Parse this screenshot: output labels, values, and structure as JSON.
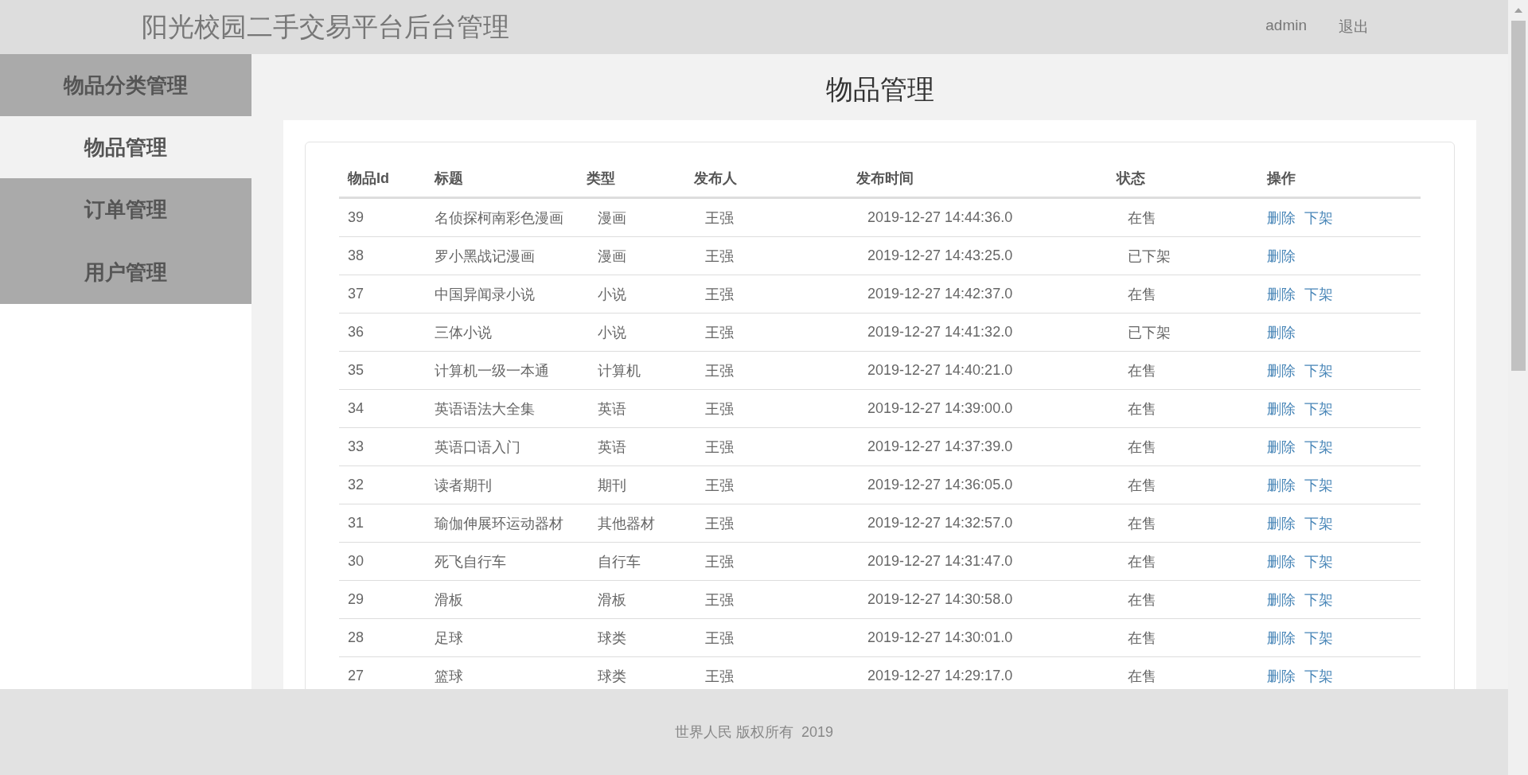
{
  "header": {
    "title": "阳光校园二手交易平台后台管理",
    "user": "admin",
    "logout": "退出"
  },
  "sidebar": {
    "items": [
      {
        "label": "物品分类管理",
        "selected": false
      },
      {
        "label": "物品管理",
        "selected": true
      },
      {
        "label": "订单管理",
        "selected": false
      },
      {
        "label": "用户管理",
        "selected": false
      }
    ]
  },
  "page_title": "物品管理",
  "table": {
    "columns": [
      "物品Id",
      "标题",
      "类型",
      "发布人",
      "发布时间",
      "状态",
      "操作"
    ],
    "rows": [
      {
        "cells": [
          "39",
          "名侦探柯南彩色漫画",
          "漫画",
          "王强",
          "2019-12-27 14:44:36.0",
          "在售"
        ],
        "actions": [
          "删除",
          "下架"
        ]
      },
      {
        "cells": [
          "38",
          "罗小黑战记漫画",
          "漫画",
          "王强",
          "2019-12-27 14:43:25.0",
          "已下架"
        ],
        "actions": [
          "删除"
        ]
      },
      {
        "cells": [
          "37",
          "中国异闻录小说",
          "小说",
          "王强",
          "2019-12-27 14:42:37.0",
          "在售"
        ],
        "actions": [
          "删除",
          "下架"
        ]
      },
      {
        "cells": [
          "36",
          "三体小说",
          "小说",
          "王强",
          "2019-12-27 14:41:32.0",
          "已下架"
        ],
        "actions": [
          "删除"
        ]
      },
      {
        "cells": [
          "35",
          "计算机一级一本通",
          "计算机",
          "王强",
          "2019-12-27 14:40:21.0",
          "在售"
        ],
        "actions": [
          "删除",
          "下架"
        ]
      },
      {
        "cells": [
          "34",
          "英语语法大全集",
          "英语",
          "王强",
          "2019-12-27 14:39:00.0",
          "在售"
        ],
        "actions": [
          "删除",
          "下架"
        ]
      },
      {
        "cells": [
          "33",
          "英语口语入门",
          "英语",
          "王强",
          "2019-12-27 14:37:39.0",
          "在售"
        ],
        "actions": [
          "删除",
          "下架"
        ]
      },
      {
        "cells": [
          "32",
          "读者期刊",
          "期刊",
          "王强",
          "2019-12-27 14:36:05.0",
          "在售"
        ],
        "actions": [
          "删除",
          "下架"
        ]
      },
      {
        "cells": [
          "31",
          "瑜伽伸展环运动器材",
          "其他器材",
          "王强",
          "2019-12-27 14:32:57.0",
          "在售"
        ],
        "actions": [
          "删除",
          "下架"
        ]
      },
      {
        "cells": [
          "30",
          "死飞自行车",
          "自行车",
          "王强",
          "2019-12-27 14:31:47.0",
          "在售"
        ],
        "actions": [
          "删除",
          "下架"
        ]
      },
      {
        "cells": [
          "29",
          "滑板",
          "滑板",
          "王强",
          "2019-12-27 14:30:58.0",
          "在售"
        ],
        "actions": [
          "删除",
          "下架"
        ]
      },
      {
        "cells": [
          "28",
          "足球",
          "球类",
          "王强",
          "2019-12-27 14:30:01.0",
          "在售"
        ],
        "actions": [
          "删除",
          "下架"
        ]
      },
      {
        "cells": [
          "27",
          "篮球",
          "球类",
          "王强",
          "2019-12-27 14:29:17.0",
          "在售"
        ],
        "actions": [
          "删除",
          "下架"
        ]
      }
    ]
  },
  "footer": {
    "text": "世界人民 版权所有  2019"
  }
}
